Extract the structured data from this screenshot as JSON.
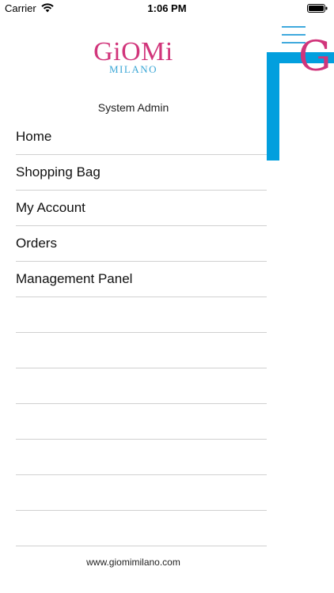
{
  "status_bar": {
    "carrier": "Carrier",
    "time": "1:06 PM",
    "wifi_icon": "wifi-icon",
    "battery_icon": "battery-icon"
  },
  "drawer": {
    "logo_name": "GiOMi",
    "logo_subtitle": "MILANO",
    "user": "System Admin",
    "items": [
      {
        "label": "Home"
      },
      {
        "label": "Shopping Bag"
      },
      {
        "label": "My Account"
      },
      {
        "label": "Orders"
      },
      {
        "label": "Management Panel"
      },
      {
        "label": ""
      },
      {
        "label": ""
      },
      {
        "label": ""
      },
      {
        "label": ""
      },
      {
        "label": ""
      },
      {
        "label": ""
      },
      {
        "label": ""
      }
    ],
    "footer": "www.giomimilano.com"
  },
  "main": {
    "menu_icon": "hamburger-menu-icon",
    "logo_partial": "G"
  },
  "colors": {
    "brand_pink": "#d1357b",
    "brand_blue": "#029fde",
    "divider": "#d0d0d0"
  }
}
